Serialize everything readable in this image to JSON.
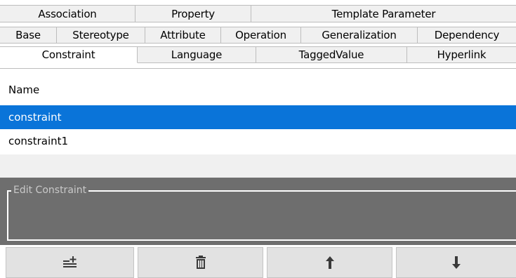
{
  "tabs": {
    "row1": [
      "Association",
      "Property",
      "Template Parameter"
    ],
    "row2": [
      "Base",
      "Stereotype",
      "Attribute",
      "Operation",
      "Generalization",
      "Dependency"
    ],
    "row3": [
      "Constraint",
      "Language",
      "TaggedValue",
      "Hyperlink"
    ],
    "selected": "Constraint"
  },
  "list": {
    "column_header": "Name",
    "items": [
      "constraint",
      "constraint1"
    ],
    "selected_item": "constraint"
  },
  "edit": {
    "legend": "Edit Constraint"
  },
  "toolbar": {
    "buttons": [
      {
        "icon": "add-list-icon"
      },
      {
        "icon": "trash-icon"
      },
      {
        "icon": "arrow-up-icon"
      },
      {
        "icon": "arrow-down-icon"
      }
    ]
  },
  "colors": {
    "selection": "#0a74d9",
    "edit_background": "#6e6e6e",
    "tab_background": "#f0f0f0"
  }
}
